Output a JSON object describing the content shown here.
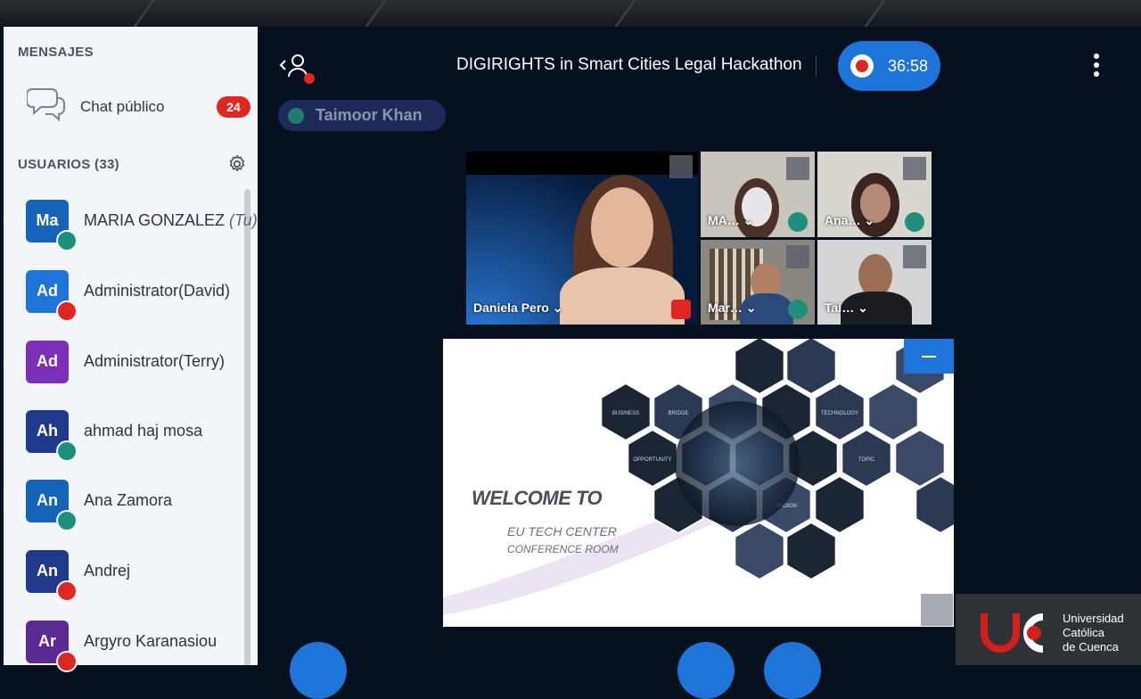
{
  "sidebar": {
    "messages_title": "MENSAJES",
    "public_chat_label": "Chat público",
    "unread_count": "24",
    "users_title": "USUARIOS (33)",
    "users": [
      {
        "initials": "Ma",
        "name": "MARIA GONZALEZ ",
        "suffix": "(Tu)",
        "avatar_color": "#1463b8",
        "status": "headset"
      },
      {
        "initials": "Ad",
        "name": "Administrator(David)",
        "suffix": "",
        "avatar_color": "#1e74d9",
        "status": "mic-red"
      },
      {
        "initials": "Ad",
        "name": "Administrator(Terry)",
        "suffix": "",
        "avatar_color": "#7b2fb8",
        "status": "none"
      },
      {
        "initials": "Ah",
        "name": "ahmad haj mosa",
        "suffix": "",
        "avatar_color": "#1f3a8a",
        "status": "headset"
      },
      {
        "initials": "An",
        "name": "Ana Zamora",
        "suffix": "",
        "avatar_color": "#1463b8",
        "status": "headset"
      },
      {
        "initials": "An",
        "name": "Andrej",
        "suffix": "",
        "avatar_color": "#1f3a8a",
        "status": "muted"
      },
      {
        "initials": "Ar",
        "name": "Argyro Karanasiou",
        "suffix": "",
        "avatar_color": "#5b2a91",
        "status": "muted"
      }
    ]
  },
  "header": {
    "meeting_title": "DIGIRIGHTS  in Smart Cities Legal Hackathon",
    "recording_time": "36:58",
    "talking_user": "Taimoor Khan"
  },
  "videos": [
    {
      "label": "Daniela Pero ⌄",
      "status": "muted"
    },
    {
      "label": "MA… ⌄",
      "status": "headset"
    },
    {
      "label": "Ana… ⌄",
      "status": "headset"
    },
    {
      "label": "Mar… ⌄",
      "status": "headset"
    },
    {
      "label": "Tai… ⌄",
      "status": "none"
    }
  ],
  "presentation": {
    "welcome": "WELCOME TO",
    "line1": "EU TECH CENTER",
    "line2": "CONFERENCE ROOM",
    "hex_labels": [
      "BUSINESS",
      "BRIDGE",
      "TECHNOLOGY",
      "OPPORTUNITY",
      "TOPIC",
      "REGION"
    ]
  },
  "logo": {
    "line1": "Universidad",
    "line2": "Católica",
    "line3": "de Cuenca"
  },
  "colors": {
    "accent": "#1e74d9",
    "alert": "#df2721",
    "headset": "#1e8f7d",
    "background": "#06101e"
  }
}
